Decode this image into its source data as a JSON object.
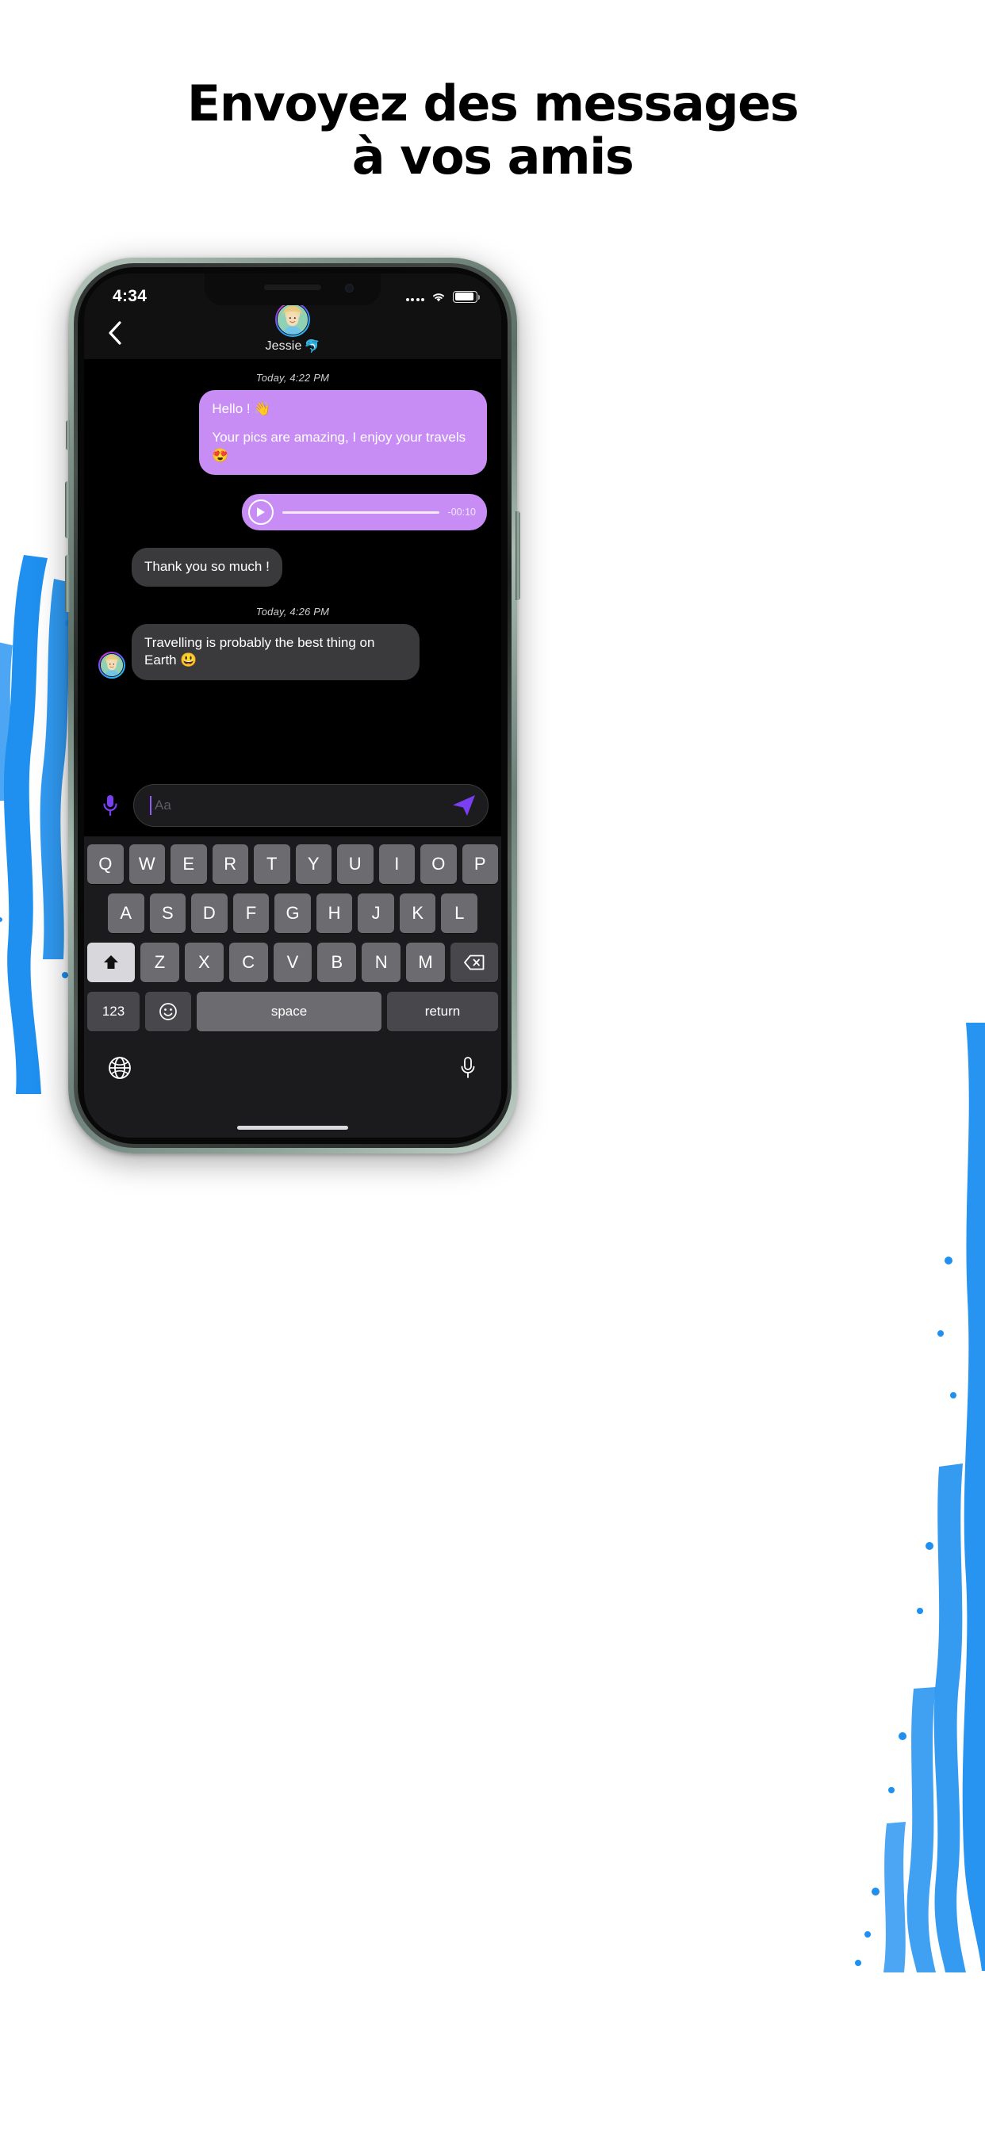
{
  "headline": {
    "line1": "Envoyez des messages",
    "line2": "à vos amis"
  },
  "colors": {
    "accent_purple": "#c78df5",
    "bubble_incoming": "#3a3a3c",
    "send_icon": "#7b3ff2",
    "mic_icon": "#7b3ff2",
    "splash_blue": "#1f90f0",
    "phone_frame": "#8fa69b"
  },
  "status_bar": {
    "time": "4:34",
    "signal_icon": "signal-dots-icon",
    "wifi_icon": "wifi-icon",
    "battery_icon": "battery-icon"
  },
  "chat_header": {
    "back_icon": "chevron-left-icon",
    "contact_name": "Jessie",
    "contact_emoji": "🐬",
    "avatar_icon": "avatar"
  },
  "conversation": [
    {
      "kind": "timestamp",
      "text": "Today, 4:22 PM"
    },
    {
      "kind": "bubble",
      "side": "out",
      "lines": [
        "Hello ! 👋",
        "Your pics are amazing, I enjoy your travels 😍"
      ]
    },
    {
      "kind": "voice",
      "side": "out",
      "play_icon": "play-icon",
      "duration": "-00:10"
    },
    {
      "kind": "bubble",
      "side": "in",
      "lines": [
        "Thank you so much !"
      ],
      "avatar": false
    },
    {
      "kind": "timestamp",
      "text": "Today, 4:26 PM"
    },
    {
      "kind": "bubble",
      "side": "in",
      "lines": [
        "Travelling is probably the best thing on Earth 😃"
      ],
      "avatar": true
    }
  ],
  "composer": {
    "mic_icon": "microphone-icon",
    "placeholder": "Aa",
    "value": "",
    "send_icon": "send-icon"
  },
  "keyboard": {
    "row1": [
      "Q",
      "W",
      "E",
      "R",
      "T",
      "Y",
      "U",
      "I",
      "O",
      "P"
    ],
    "row2": [
      "A",
      "S",
      "D",
      "F",
      "G",
      "H",
      "J",
      "K",
      "L"
    ],
    "row3": [
      "Z",
      "X",
      "C",
      "V",
      "B",
      "N",
      "M"
    ],
    "shift_icon": "shift-up-icon",
    "backspace_icon": "backspace-icon",
    "numbers_label": "123",
    "emoji_icon": "smiley-icon",
    "space_label": "space",
    "return_label": "return",
    "globe_icon": "globe-icon",
    "dictation_icon": "microphone-icon"
  }
}
